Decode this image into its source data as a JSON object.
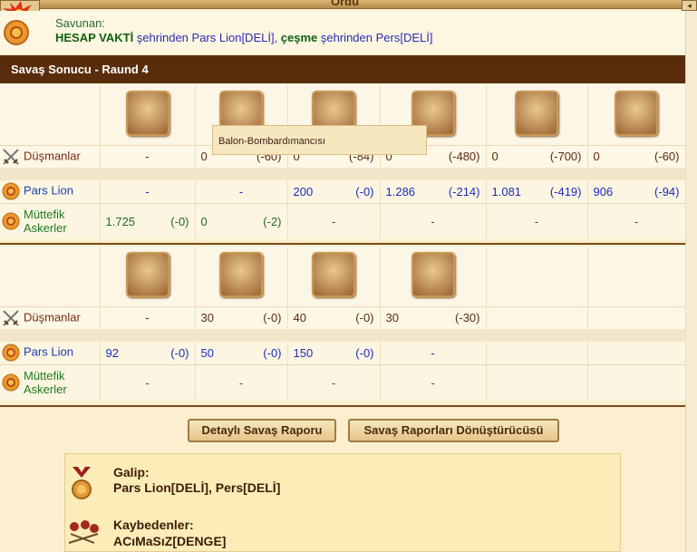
{
  "window": {
    "title": "Ordu",
    "corner_label": "◂"
  },
  "defender": {
    "label": "Savunan:",
    "user": "HESAP VAKTİ",
    "from1": " şehrinden Pars Lion[DELİ], ",
    "town": "çeşme",
    "from2": " şehrinden Pers[DELİ]"
  },
  "round_title": "Savaş Sonucu - Raund 4",
  "tooltip": "Balon-Bombardımancısı",
  "rows": {
    "enemies": "Düşmanlar",
    "attacker": "Pars Lion",
    "allies_l1": "Müttefik",
    "allies_l2": "Askerler"
  },
  "table1": {
    "units": [
      "swordsman-unit",
      "balloon-bomber-unit",
      "hoplite-unit",
      "mortar-unit",
      "spearman-unit",
      "catapult-unit"
    ],
    "enemies": [
      [
        "-",
        ""
      ],
      [
        "0",
        "(-60)"
      ],
      [
        "0",
        "(-84)"
      ],
      [
        "0",
        "(-480)"
      ],
      [
        "0",
        "(-700)"
      ],
      [
        "0",
        "(-60)"
      ]
    ],
    "attacker": [
      [
        "-",
        ""
      ],
      [
        "-",
        ""
      ],
      [
        "200",
        "(-0)"
      ],
      [
        "1.286",
        "(-214)"
      ],
      [
        "1.081",
        "(-419)"
      ],
      [
        "906",
        "(-94)"
      ]
    ],
    "allies": [
      [
        "1.725",
        "(-0)"
      ],
      [
        "0",
        "(-2)"
      ],
      [
        "-",
        ""
      ],
      [
        "-",
        ""
      ],
      [
        "-",
        ""
      ],
      [
        "-",
        ""
      ]
    ]
  },
  "table2": {
    "units": [
      "ram-unit",
      "doctor-unit",
      "cook-unit",
      "gunner-unit"
    ],
    "enemies": [
      [
        "-",
        ""
      ],
      [
        "30",
        "(-0)"
      ],
      [
        "40",
        "(-0)"
      ],
      [
        "30",
        "(-30)"
      ]
    ],
    "attacker": [
      [
        "92",
        "(-0)"
      ],
      [
        "50",
        "(-0)"
      ],
      [
        "150",
        "(-0)"
      ],
      [
        "-",
        ""
      ]
    ],
    "allies": [
      [
        "-",
        ""
      ],
      [
        "-",
        ""
      ],
      [
        "-",
        ""
      ],
      [
        "-",
        ""
      ]
    ]
  },
  "buttons": {
    "detail": "Detaylı Savaş Raporu",
    "converter": "Savaş Raporları Dönüştürücüsü"
  },
  "summary": {
    "winner_label": "Galip:",
    "winners": "Pars Lion[DELİ], Pers[DELİ]",
    "loser_label": "Kaybedenler:",
    "losers": "ACıMaSıZ[DENGE]"
  },
  "colors": {
    "header_bg": "#592d0b",
    "enemy": "#7a2b14",
    "attacker": "#1c3fb0",
    "ally": "#1f7a1f"
  }
}
